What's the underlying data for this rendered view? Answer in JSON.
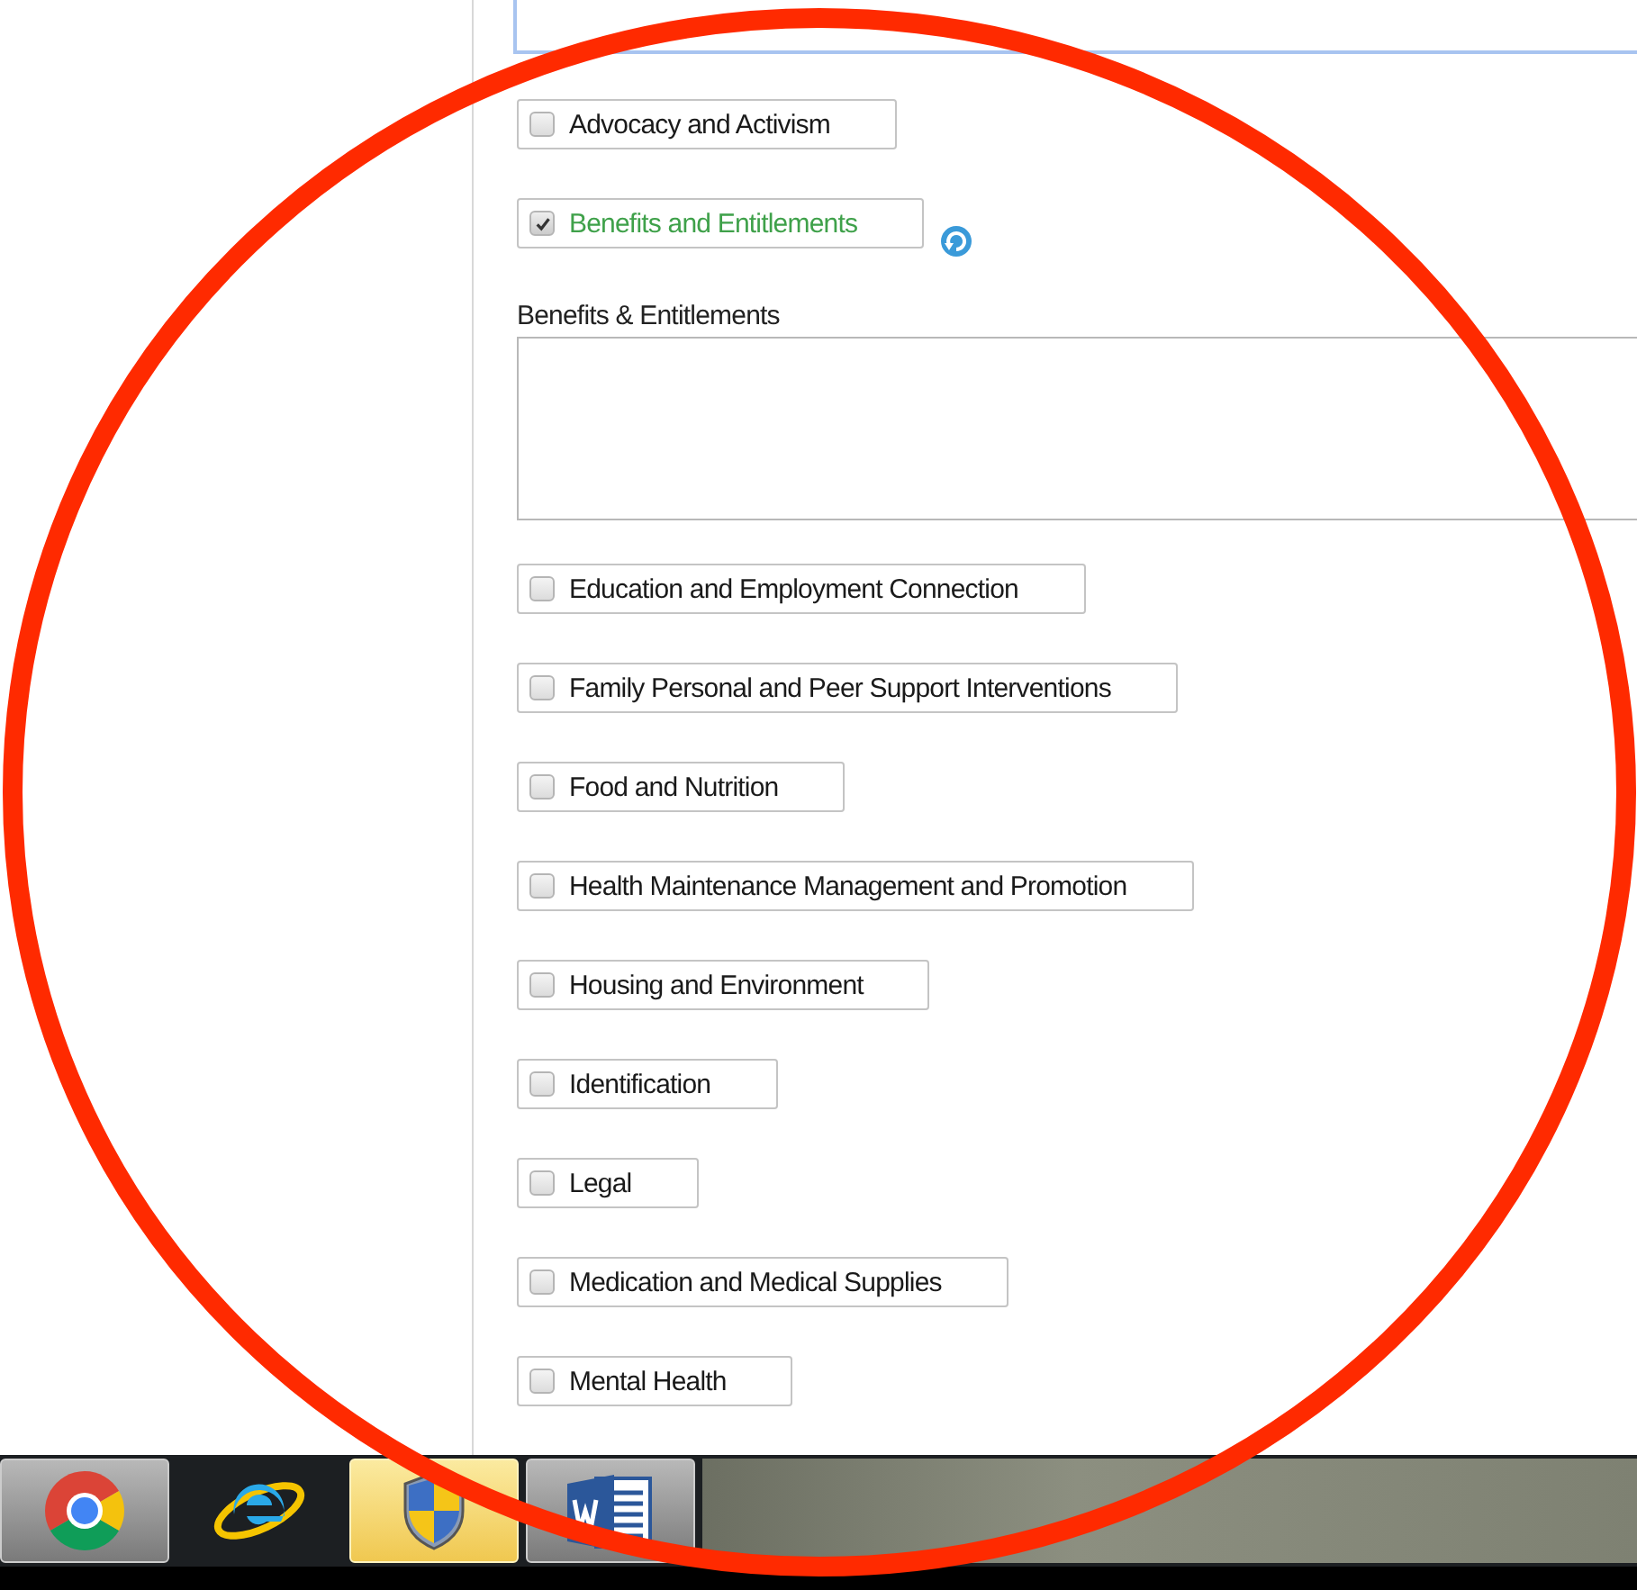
{
  "items": [
    {
      "label": "Advocacy and Activism",
      "checked": false
    },
    {
      "label": "Benefits and Entitlements",
      "checked": true,
      "note": {
        "label": "Benefits & Entitlements"
      }
    },
    {
      "label": "Education and Employment Connection",
      "checked": false
    },
    {
      "label": "Family Personal and Peer Support Interventions",
      "checked": false
    },
    {
      "label": "Food and Nutrition",
      "checked": false
    },
    {
      "label": "Health Maintenance Management and Promotion",
      "checked": false
    },
    {
      "label": "Housing and Environment",
      "checked": false
    },
    {
      "label": "Identification",
      "checked": false
    },
    {
      "label": "Legal",
      "checked": false
    },
    {
      "label": "Medication and Medical Supplies",
      "checked": false
    },
    {
      "label": "Mental Health",
      "checked": false
    }
  ],
  "taskbar": [
    {
      "kind": "chrome",
      "running": true,
      "selected": false
    },
    {
      "kind": "ie",
      "running": false,
      "selected": false
    },
    {
      "kind": "shield",
      "running": true,
      "selected": true
    },
    {
      "kind": "word",
      "running": true,
      "selected": false
    }
  ]
}
